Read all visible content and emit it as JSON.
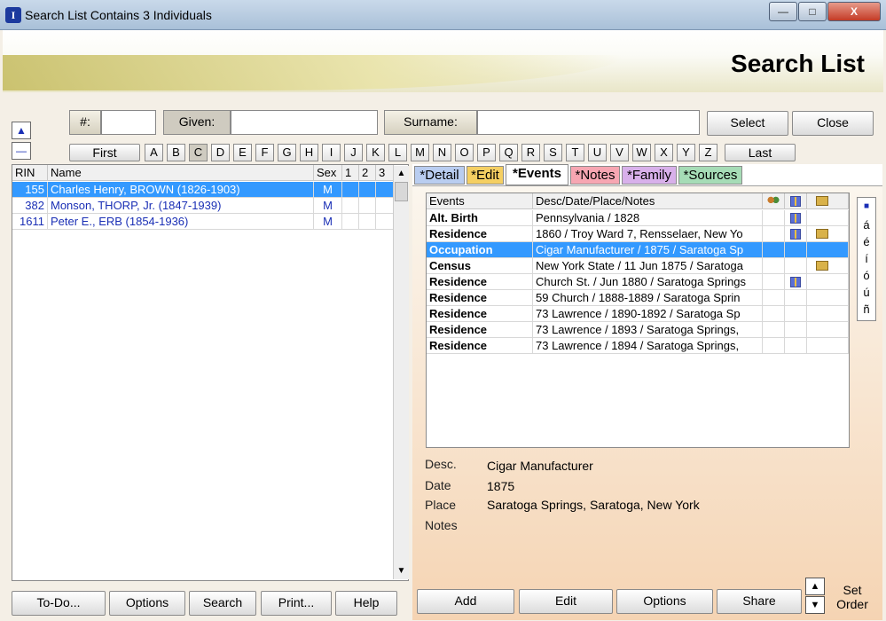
{
  "window": {
    "title": "Search List Contains 3 Individuals",
    "app_icon_letter": "I",
    "minimize_label": "—",
    "maximize_label": "□",
    "close_label": "X"
  },
  "page_title": "Search List",
  "search": {
    "number_label": "#:",
    "number_value": "",
    "given_label": "Given:",
    "given_value": "",
    "surname_label": "Surname:",
    "surname_value": "",
    "select_label": "Select",
    "close_label": "Close"
  },
  "nav": {
    "up_arrow": "▲",
    "minus": "—",
    "first_label": "First",
    "last_label": "Last",
    "letters": [
      "A",
      "B",
      "C",
      "D",
      "E",
      "F",
      "G",
      "H",
      "I",
      "J",
      "K",
      "L",
      "M",
      "N",
      "O",
      "P",
      "Q",
      "R",
      "S",
      "T",
      "U",
      "V",
      "W",
      "X",
      "Y",
      "Z"
    ],
    "selected_letter": "C"
  },
  "list": {
    "columns": [
      "RIN",
      "Name",
      "Sex",
      "1",
      "2",
      "3"
    ],
    "rows": [
      {
        "rin": "155",
        "name": "Charles Henry, BROWN (1826-1903)",
        "sex": "M",
        "selected": true
      },
      {
        "rin": "382",
        "name": "Monson, THORP, Jr. (1847-1939)",
        "sex": "M",
        "selected": false
      },
      {
        "rin": "1611",
        "name": "Peter E., ERB (1854-1936)",
        "sex": "M",
        "selected": false
      }
    ]
  },
  "bottom_left": {
    "todo_label": "To-Do...",
    "options_label": "Options",
    "search_label": "Search",
    "print_label": "Print...",
    "help_label": "Help"
  },
  "tabs": [
    {
      "label": "*Detail",
      "color": "#b9cdf0"
    },
    {
      "label": "*Edit",
      "color": "#f5cf62"
    },
    {
      "label": "*Events",
      "color": "#ffffff",
      "active": true
    },
    {
      "label": "*Notes",
      "color": "#f7a6b2"
    },
    {
      "label": "*Family",
      "color": "#d8b0ea"
    },
    {
      "label": "*Sources",
      "color": "#a6dcb6"
    }
  ],
  "events": {
    "columns": [
      "Events",
      "Desc/Date/Place/Notes"
    ],
    "icon_columns": [
      "people-icon",
      "book-icon",
      "photo-icon"
    ],
    "rows": [
      {
        "event": "Alt. Birth",
        "desc": "Pennsylvania / 1828",
        "book": true,
        "photo": false,
        "selected": false
      },
      {
        "event": "Residence",
        "desc": "1860 / Troy Ward 7, Rensselaer, New Yo",
        "book": true,
        "photo": true,
        "selected": false
      },
      {
        "event": "Occupation",
        "desc": "Cigar Manufacturer / 1875 / Saratoga Sp",
        "book": false,
        "photo": false,
        "selected": true
      },
      {
        "event": "Census",
        "desc": "New York State / 11 Jun 1875 / Saratoga",
        "book": false,
        "photo": true,
        "selected": false
      },
      {
        "event": "Residence",
        "desc": "Church St. / Jun 1880 / Saratoga Springs",
        "book": true,
        "photo": false,
        "selected": false
      },
      {
        "event": "Residence",
        "desc": "59 Church / 1888-1889 / Saratoga Sprin",
        "book": false,
        "photo": false,
        "selected": false
      },
      {
        "event": "Residence",
        "desc": "73 Lawrence / 1890-1892 / Saratoga Sp",
        "book": false,
        "photo": false,
        "selected": false
      },
      {
        "event": "Residence",
        "desc": "73 Lawrence / 1893 / Saratoga Springs,",
        "book": false,
        "photo": false,
        "selected": false
      },
      {
        "event": "Residence",
        "desc": "73 Lawrence / 1894 / Saratoga Springs,",
        "book": false,
        "photo": false,
        "selected": false
      }
    ]
  },
  "accents": [
    "■",
    "á",
    "é",
    "í",
    "ó",
    "ú",
    "ñ"
  ],
  "detail": {
    "desc_label": "Desc.",
    "desc_value": "Cigar Manufacturer",
    "date_label": "Date",
    "date_value": "1875",
    "place_label": "Place",
    "place_value": "Saratoga Springs, Saratoga, New York",
    "notes_label": "Notes",
    "notes_value": ""
  },
  "bottom_right": {
    "add_label": "Add",
    "edit_label": "Edit",
    "options_label": "Options",
    "share_label": "Share",
    "up": "▲",
    "down": "▼",
    "set_order_label": "Set Order"
  }
}
